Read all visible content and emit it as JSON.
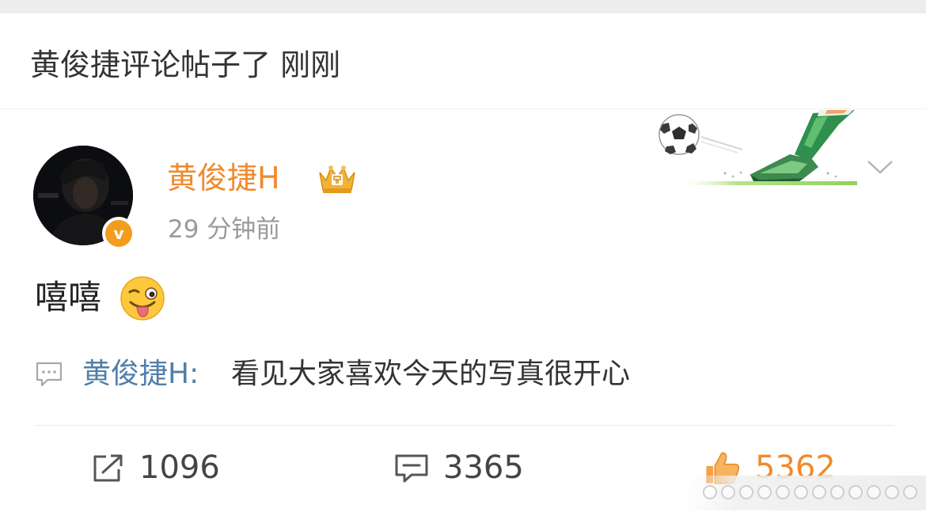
{
  "caption": {
    "text": "黄俊捷评论帖子了 刚刚"
  },
  "post": {
    "author": "黄俊捷H",
    "timestamp": "29 分钟前",
    "text": "嘻嘻",
    "verified_badge": "v",
    "emoji": "winking-tongue-face",
    "reply": {
      "user": "黄俊捷H:",
      "text": "看见大家喜欢今天的写真很开心"
    }
  },
  "actions": {
    "share_count": "1096",
    "comment_count": "3365",
    "like_count": "5362"
  },
  "colors": {
    "username": "#f08a2c",
    "reply_user": "#4f7fa9",
    "like": "#f08a2c",
    "badge": "#f39c1e"
  }
}
